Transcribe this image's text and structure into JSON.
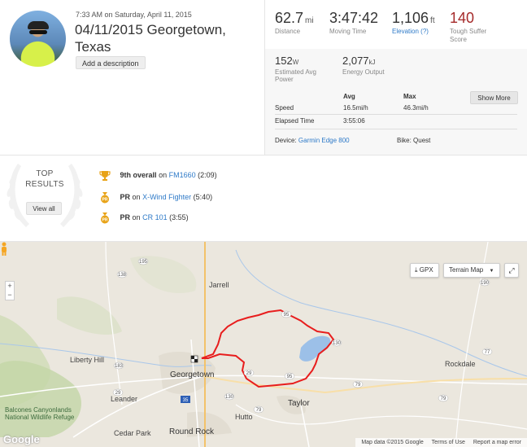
{
  "activity": {
    "datetime": "7:33 AM on Saturday, April 11, 2015",
    "title": "04/11/2015 Georgetown, Texas",
    "add_description": "Add a description"
  },
  "stats": {
    "distance": {
      "value": "62.7",
      "unit": "mi",
      "label": "Distance"
    },
    "moving_time": {
      "value": "3:47:42",
      "label": "Moving Time"
    },
    "elevation": {
      "value": "1,106",
      "unit": "ft",
      "label": "Elevation",
      "help": "(?)"
    },
    "suffer": {
      "value": "140",
      "label_line1": "Tough Suffer",
      "label_line2": "Score"
    },
    "power": {
      "value": "152",
      "unit": "W",
      "label_line1": "Estimated Avg",
      "label_line2": "Power"
    },
    "energy": {
      "value": "2,077",
      "unit": "kJ",
      "label": "Energy Output"
    },
    "show_more": "Show More",
    "table": {
      "col_avg": "Avg",
      "col_max": "Max",
      "speed_label": "Speed",
      "speed_avg": "16.5mi/h",
      "speed_max": "46.3mi/h",
      "elapsed_label": "Elapsed Time",
      "elapsed_avg": "3:55:06"
    },
    "device_label": "Device:",
    "device_value": "Garmin Edge 800",
    "bike_label": "Bike:",
    "bike_value": "Quest"
  },
  "top_results": {
    "title_line1": "TOP",
    "title_line2": "RESULTS",
    "view_all": "View all",
    "items": [
      {
        "rank": "9th overall",
        "on": "on",
        "segment": "FM1660",
        "time": "(2:09)",
        "icon": "trophy-icon"
      },
      {
        "rank": "PR",
        "on": "on",
        "segment": "X-Wind Fighter",
        "time": "(5:40)",
        "icon": "pr-medal-icon"
      },
      {
        "rank": "PR",
        "on": "on",
        "segment": "CR 101",
        "time": "(3:55)",
        "icon": "pr-medal-icon"
      }
    ]
  },
  "map": {
    "gpx": "GPX",
    "map_type": "Terrain Map",
    "places": {
      "jarrell": "Jarrell",
      "liberty_hill": "Liberty Hill",
      "georgetown": "Georgetown",
      "leander": "Leander",
      "cedar_park": "Cedar Park",
      "round_rock": "Round Rock",
      "hutto": "Hutto",
      "taylor": "Taylor",
      "rockdale": "Rockdale",
      "balcones_1": "Balcones Canyonlands",
      "balcones_2": "National Wildlife Refuge"
    },
    "roads": [
      "195",
      "138",
      "183",
      "29",
      "95",
      "79",
      "35",
      "130",
      "95",
      "29",
      "79",
      "36",
      "190",
      "77",
      "183"
    ],
    "footer": {
      "data": "Map data ©2015 Google",
      "terms": "Terms of Use",
      "report": "Report a map error"
    },
    "google": "Google"
  }
}
